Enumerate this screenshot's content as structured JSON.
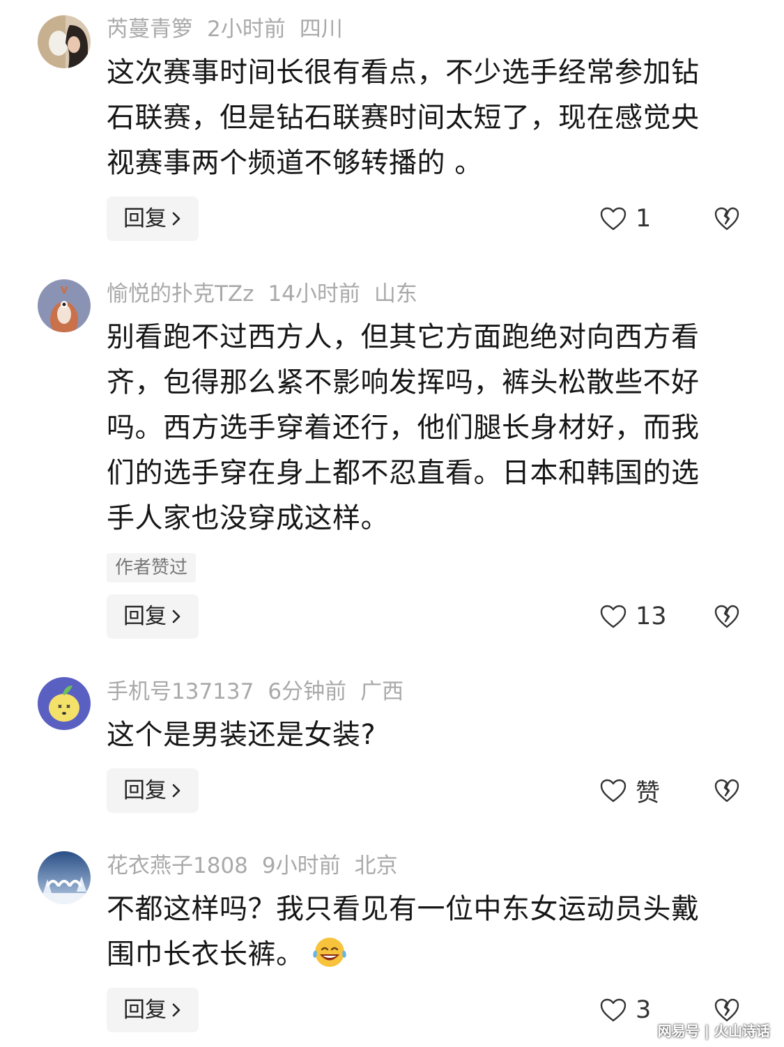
{
  "reply_label": "回复",
  "comments": [
    {
      "username": "芮蔓青箩",
      "time": "2小时前",
      "location": "四川",
      "text": "这次赛事时间长很有看点，不少选手经常参加钻\n石联赛，但是钻石联赛时间太短了，现在感觉央\n视赛事两个频道不够转播的 。",
      "likes": "1"
    },
    {
      "username": "愉悦的扑克TZz",
      "time": "14小时前",
      "location": "山东",
      "text": "别看跑不过西方人，但其它方面跑绝对向西方看\n齐，包得那么紧不影响发挥吗，裤头松散些不好\n吗。西方选手穿着还行，他们腿长身材好，而我\n们的选手穿在身上都不忍直看。日本和韩国的选\n手人家也没穿成这样。",
      "badge": "作者赞过",
      "likes": "13"
    },
    {
      "username": "手机号137137",
      "time": "6分钟前",
      "location": "广西",
      "text": "这个是男装还是女装?",
      "likes": "赞"
    },
    {
      "username": "花衣燕子1808",
      "time": "9小时前",
      "location": "北京",
      "text": "不都这样吗？我只看见有一位中东女运动员头戴\n围巾长衣长裤。",
      "emoji": "laughing-tears-emoji",
      "likes": "3"
    }
  ],
  "watermark": "网易号 | 火山诗话",
  "colors": {
    "meta": "#a9a9a9",
    "button_bg": "#f4f4f4",
    "text": "#161616"
  }
}
